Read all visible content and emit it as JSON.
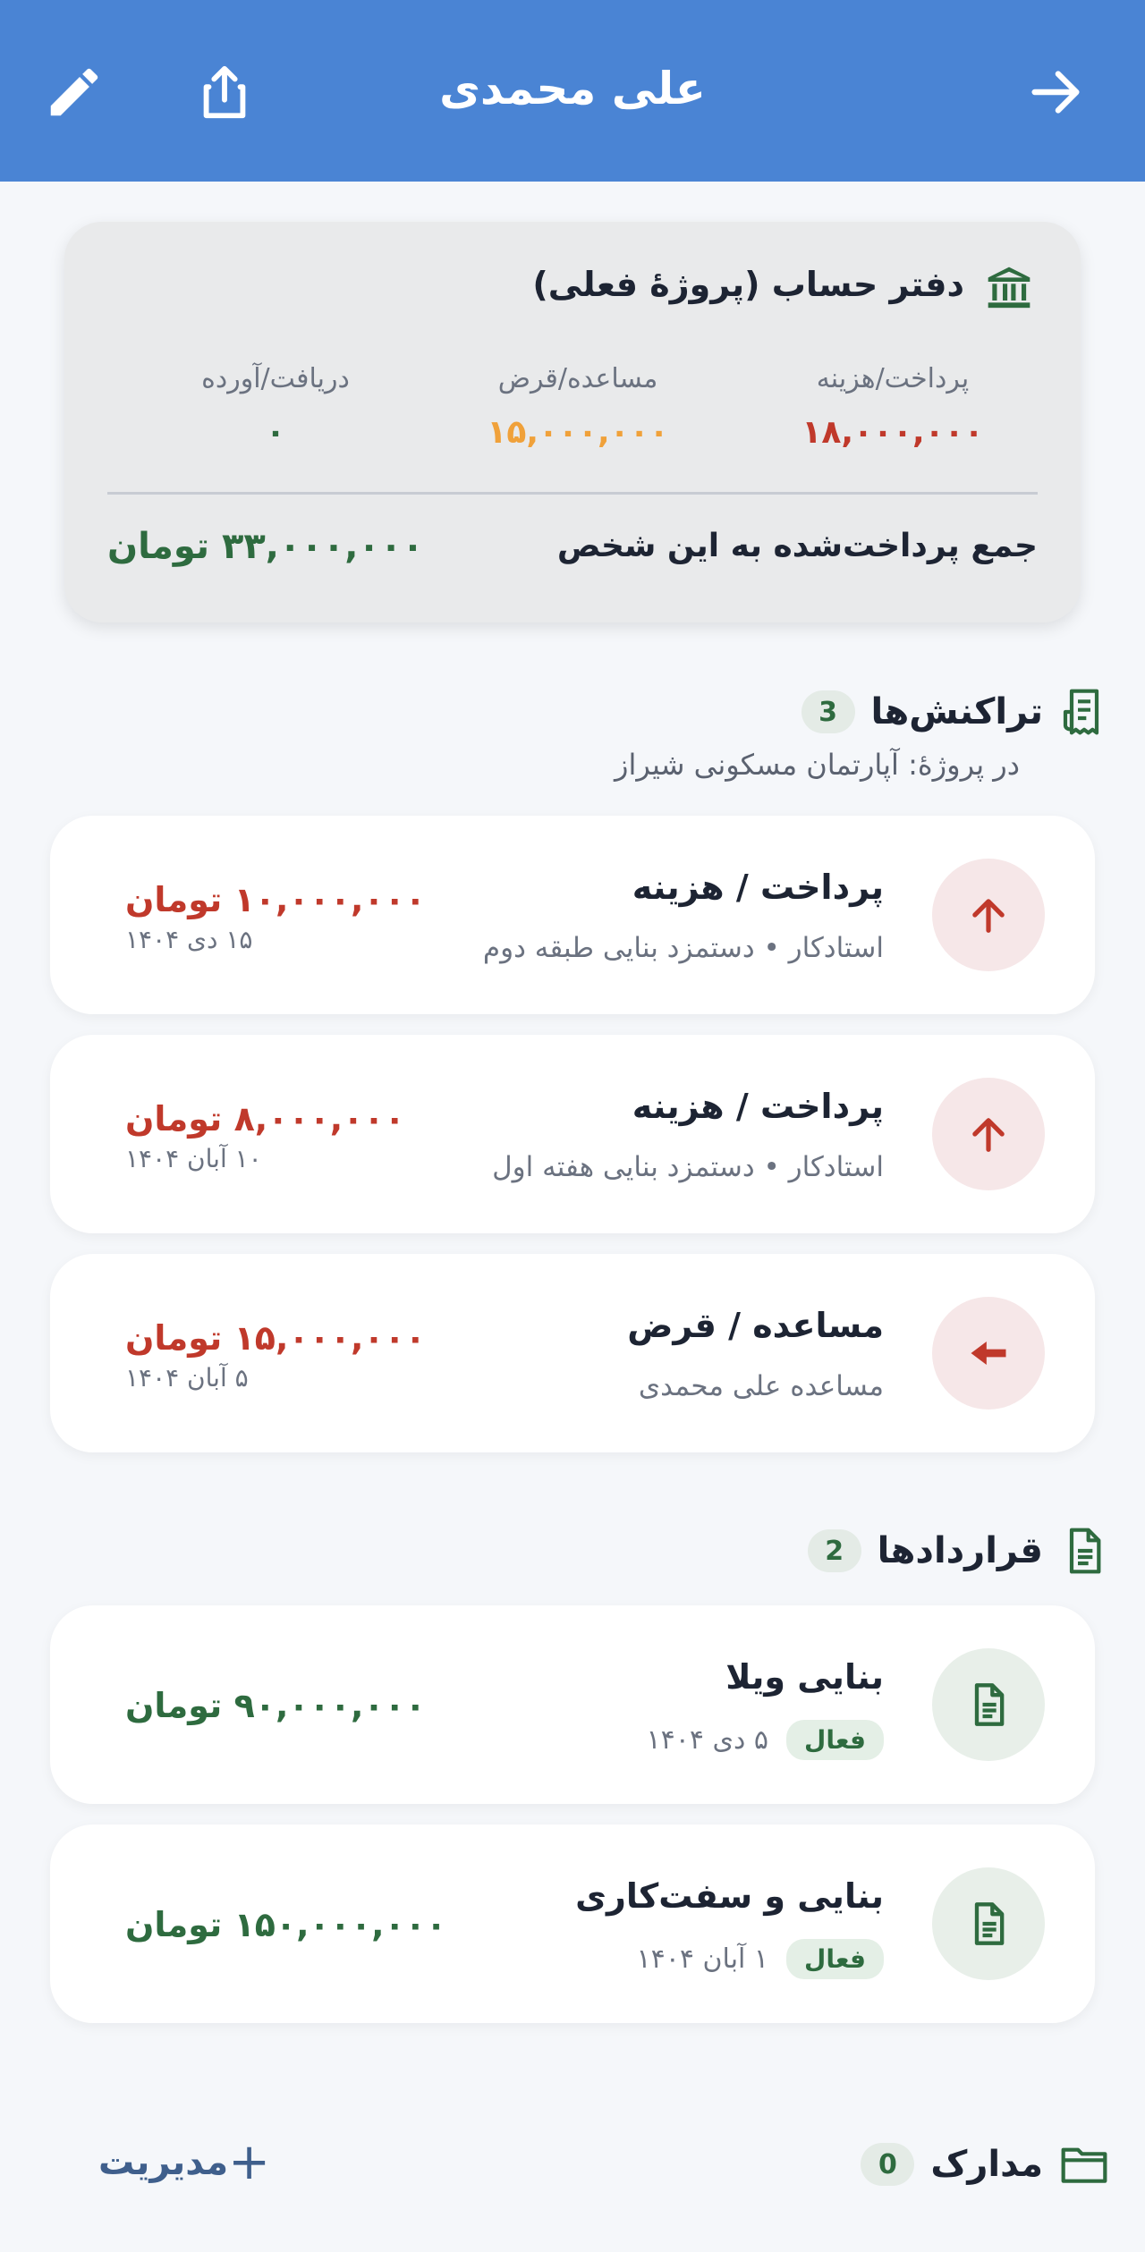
{
  "header": {
    "title": "علی محمدی"
  },
  "ledger": {
    "title": "دفتر حساب (پروژهٔ فعلی)",
    "stats": [
      {
        "label": "پرداخت/هزینه",
        "value": "۱۸,۰۰۰,۰۰۰",
        "color": "#c0392b"
      },
      {
        "label": "مساعده/قرض",
        "value": "۱۵,۰۰۰,۰۰۰",
        "color": "#f0a13a"
      },
      {
        "label": "دریافت/آورده",
        "value": "۰",
        "color": "#2e6b3f"
      }
    ],
    "total_label": "جمع پرداخت‌شده به این شخص",
    "total_value": "۳۳,۰۰۰,۰۰۰ تومان"
  },
  "transactions": {
    "title": "تراکنش‌ها",
    "count": "3",
    "subtitle": "در پروژهٔ: آپارتمان مسکونی شیراز",
    "items": [
      {
        "title": "پرداخت / هزینه",
        "subtitle": "استادکار • دستمزد بنایی طبقه دوم",
        "amount": "۱۰,۰۰۰,۰۰۰ تومان",
        "date": "۱۵ دی ۱۴۰۴",
        "icon": "arrow-up-icon"
      },
      {
        "title": "پرداخت / هزینه",
        "subtitle": "استادکار • دستمزد بنایی هفته اول",
        "amount": "۸,۰۰۰,۰۰۰ تومان",
        "date": "۱۰ آبان ۱۴۰۴",
        "icon": "arrow-up-icon"
      },
      {
        "title": "مساعده / قرض",
        "subtitle": "مساعده علی محمدی",
        "amount": "۱۵,۰۰۰,۰۰۰ تومان",
        "date": "۵ آبان ۱۴۰۴",
        "icon": "arrow-left-icon"
      }
    ]
  },
  "contracts": {
    "title": "قراردادها",
    "count": "2",
    "items": [
      {
        "title": "بنایی ویلا",
        "status": "فعال",
        "date": "۵ دی ۱۴۰۴",
        "amount": "۹۰,۰۰۰,۰۰۰ تومان"
      },
      {
        "title": "بنایی و سفت‌کاری",
        "status": "فعال",
        "date": "۱ آبان ۱۴۰۴",
        "amount": "۱۵۰,۰۰۰,۰۰۰ تومان"
      }
    ]
  },
  "documents": {
    "title": "مدارک",
    "count": "0",
    "manage_label": "مدیریت",
    "manage_icon": "+"
  },
  "colors": {
    "primary": "#4a84d4",
    "expense": "#c0392b",
    "loan": "#f0a13a",
    "positive": "#2e6b3f"
  }
}
